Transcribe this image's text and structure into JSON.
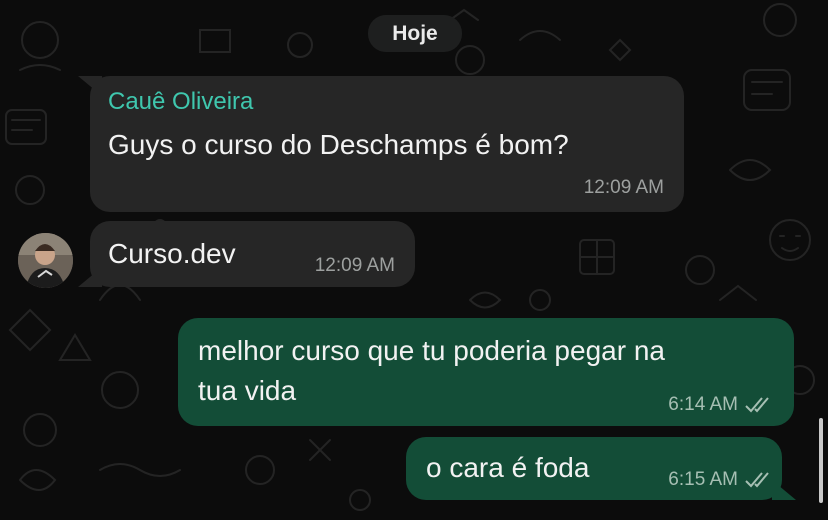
{
  "date_chip": "Hoje",
  "messages": [
    {
      "direction": "in",
      "sender": "Cauê Oliveira",
      "text": "Guys o curso do Deschamps é bom?",
      "time": "12:09 AM"
    },
    {
      "direction": "in",
      "text": "Curso.dev",
      "time": "12:09 AM"
    },
    {
      "direction": "out",
      "text_lines": [
        "melhor curso que tu poderia pegar na",
        "tua vida"
      ],
      "time": "6:14 AM",
      "status": "read"
    },
    {
      "direction": "out",
      "text": "o cara é foda",
      "time": "6:15 AM",
      "status": "read"
    }
  ],
  "colors": {
    "incoming_bubble": "#262626",
    "outgoing_bubble": "#134d37",
    "sender_name": "#3fc7ae",
    "background": "#0c0c0c"
  },
  "icons": [
    "double-check-icon",
    "avatar"
  ]
}
